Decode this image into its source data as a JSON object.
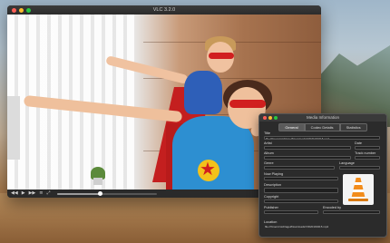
{
  "vlc_window": {
    "title": "VLC 3.2.0"
  },
  "playback": {
    "progress_fraction": 0.43
  },
  "media_info": {
    "title": "Media Information",
    "tabs": [
      {
        "label": "General",
        "active": true
      },
      {
        "label": "Codec Details",
        "active": false
      },
      {
        "label": "Statistics",
        "active": false
      }
    ],
    "fields": {
      "title_label": "Title",
      "title_value": "file:///Users/michlagel/Downloads/VID20190415.mp4",
      "artist_label": "Artist",
      "date_label": "Date",
      "album_label": "Album",
      "track_label": "Track number",
      "genre_label": "Genre",
      "language_label": "Language",
      "now_playing_label": "Now Playing",
      "description_label": "Description",
      "copyright_label": "Copyright",
      "publisher_label": "Publisher",
      "encoded_by_label": "Encoded by",
      "location_label": "Location",
      "location_value": "file:///Users/michlagel/Downloads/VID20190415.mp4"
    }
  },
  "colors": {
    "traffic_close": "#ff5f57",
    "traffic_min": "#febc2e",
    "traffic_max": "#28c840",
    "vlc_orange": "#f28c1b"
  }
}
